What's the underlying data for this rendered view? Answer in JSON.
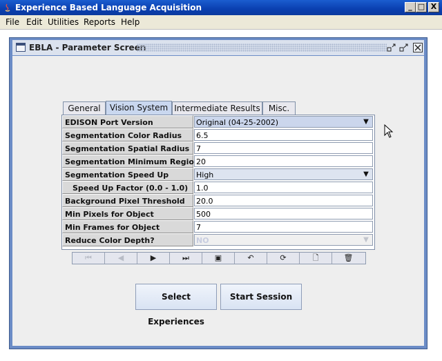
{
  "window": {
    "title": "Experience Based Language Acquisition",
    "controls": [
      "_",
      "□",
      "X"
    ]
  },
  "menubar": {
    "items": [
      "File",
      "Edit",
      "Utilities",
      "Reports",
      "Help"
    ]
  },
  "internal_frame": {
    "title": "EBLA - Parameter Screen"
  },
  "tabs": [
    {
      "label": "General",
      "selected": false
    },
    {
      "label": "Vision System",
      "selected": true
    },
    {
      "label": "Intermediate Results",
      "selected": false
    },
    {
      "label": "Misc.",
      "selected": false
    }
  ],
  "parameters": [
    {
      "label": "EDISON Port Version",
      "value": "Original (04-25-2002)",
      "type": "combo"
    },
    {
      "label": "Segmentation Color Radius",
      "value": "6.5",
      "type": "text"
    },
    {
      "label": "Segmentation Spatial Radius",
      "value": "7",
      "type": "text"
    },
    {
      "label": "Segmentation Minimum Region",
      "value": "20",
      "type": "text"
    },
    {
      "label": "Segmentation Speed Up",
      "value": "High",
      "type": "combo"
    },
    {
      "label": "Speed Up Factor (0.0 - 1.0)",
      "value": "1.0",
      "type": "text"
    },
    {
      "label": "Background Pixel Threshold",
      "value": "20.0",
      "type": "text"
    },
    {
      "label": "Min Pixels for Object",
      "value": "500",
      "type": "text"
    },
    {
      "label": "Min Frames for Object",
      "value": "7",
      "type": "text"
    },
    {
      "label": "Reduce Color Depth?",
      "value": "NO",
      "type": "combo-disabled"
    }
  ],
  "navigator": [
    {
      "icon": "first-record-icon",
      "glyph": "⏮",
      "enabled": false
    },
    {
      "icon": "previous-record-icon",
      "glyph": "◀",
      "enabled": false
    },
    {
      "icon": "next-record-icon",
      "glyph": "▶",
      "enabled": true
    },
    {
      "icon": "last-record-icon",
      "glyph": "⏭",
      "enabled": true
    },
    {
      "icon": "save-icon",
      "glyph": "▣",
      "enabled": true
    },
    {
      "icon": "undo-icon",
      "glyph": "↶",
      "enabled": true
    },
    {
      "icon": "refresh-icon",
      "glyph": "⟳",
      "enabled": true
    },
    {
      "icon": "new-record-icon",
      "glyph": "🗋",
      "enabled": true
    },
    {
      "icon": "delete-icon",
      "glyph": "🗑",
      "enabled": true
    }
  ],
  "actions": {
    "select_experiences": "Select Experiences",
    "start_session": "Start Session"
  },
  "colors": {
    "title_bar": "#0a3fb0",
    "frame_border": "#6b8cc6",
    "selected_tab": "#c9d7ef"
  }
}
